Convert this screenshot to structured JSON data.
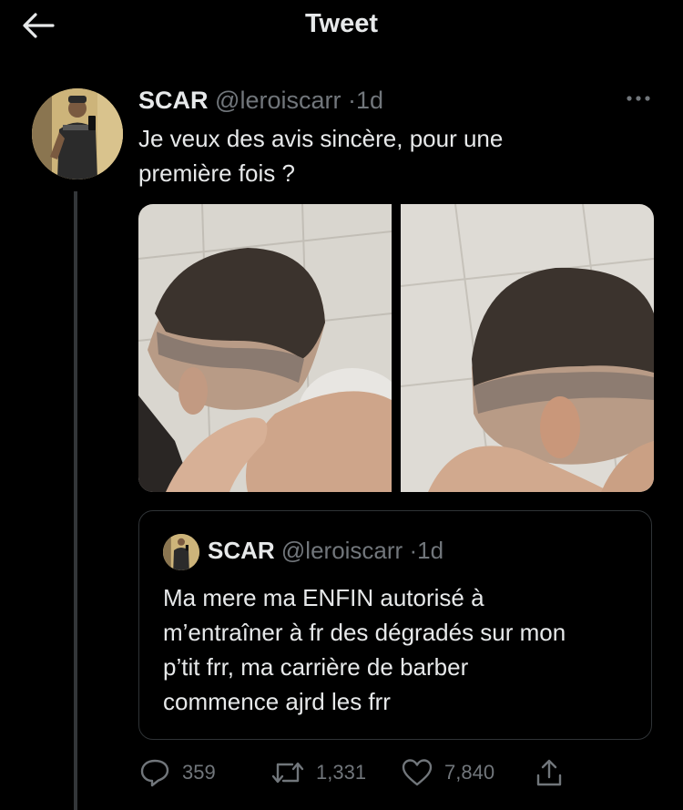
{
  "topbar": {
    "title": "Tweet",
    "back_icon": "arrow-left-icon"
  },
  "tweet": {
    "author_name": "SCAR",
    "handle": "@leroiscarr",
    "separator": "·",
    "time": "1d",
    "text_line1": "Je veux des avis sincère, pour une",
    "text_line2": "première fois ?",
    "more_icon": "more-horizontal-icon"
  },
  "quote": {
    "author_name": "SCAR",
    "handle": "@leroiscarr",
    "separator": "·",
    "time": "1d",
    "lines": [
      "Ma mere ma ENFIN autorisé à",
      "m’entraîner à fr des dégradés sur mon",
      "p’tit frr, ma carrière de barber",
      "commence ajrd les frr"
    ]
  },
  "actions": {
    "reply_count": "359",
    "retweet_count": "1,331",
    "like_count": "7,840"
  },
  "colors": {
    "background": "#000000",
    "text_primary": "#e7e9ea",
    "text_secondary": "#71767b",
    "border": "#2f3336"
  }
}
